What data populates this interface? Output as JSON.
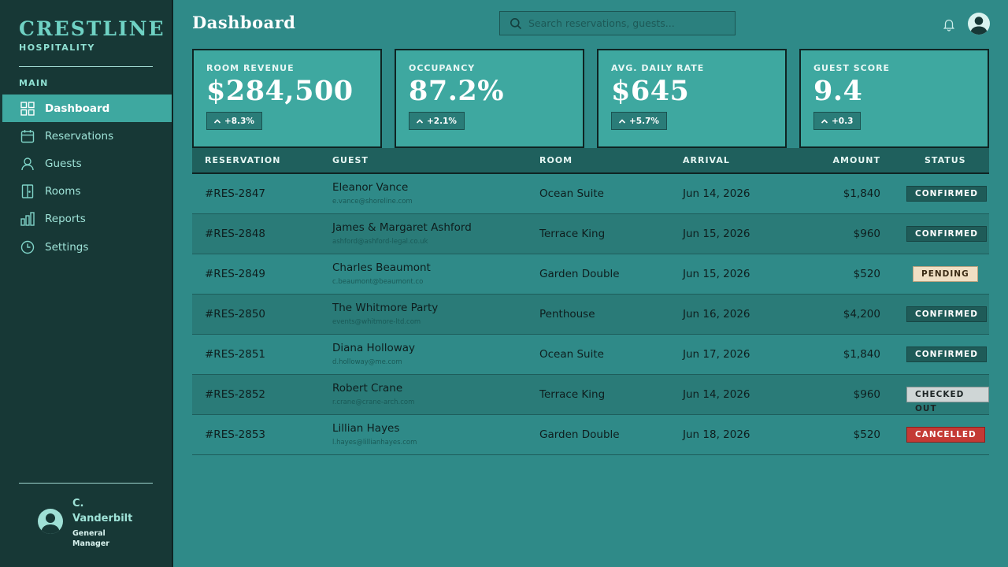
{
  "brand": {
    "name": "CRESTLINE",
    "subtitle": "HOSPITALITY"
  },
  "sidebar": {
    "section_label": "MAIN",
    "items": [
      {
        "label": "Dashboard",
        "icon": "grid-icon",
        "active": true
      },
      {
        "label": "Reservations",
        "icon": "calendar-icon",
        "active": false
      },
      {
        "label": "Guests",
        "icon": "person-icon",
        "active": false
      },
      {
        "label": "Rooms",
        "icon": "door-icon",
        "active": false
      },
      {
        "label": "Reports",
        "icon": "bar-chart-icon",
        "active": false
      },
      {
        "label": "Settings",
        "icon": "clock-icon",
        "active": false
      }
    ]
  },
  "user": {
    "name": "C. Vanderbilt",
    "role": "General Manager"
  },
  "header": {
    "title": "Dashboard",
    "search_placeholder": "Search reservations, guests..."
  },
  "kpis": [
    {
      "label": "ROOM REVENUE",
      "value": "$284,500",
      "delta": "+8.3%"
    },
    {
      "label": "OCCUPANCY",
      "value": "87.2%",
      "delta": "+2.1%"
    },
    {
      "label": "AVG. DAILY RATE",
      "value": "$645",
      "delta": "+5.7%"
    },
    {
      "label": "GUEST SCORE",
      "value": "9.4",
      "delta": "+0.3"
    }
  ],
  "table": {
    "columns": {
      "reservation": "RESERVATION",
      "guest": "GUEST",
      "room": "ROOM",
      "arrival": "ARRIVAL",
      "amount": "AMOUNT",
      "status": "STATUS"
    },
    "rows": [
      {
        "id": "#RES-2847",
        "guest": "Eleanor Vance",
        "email": "e.vance@shoreline.com",
        "room": "Ocean Suite",
        "arrival": "Jun 14, 2026",
        "amount": "$1,840",
        "status": "CONFIRMED"
      },
      {
        "id": "#RES-2848",
        "guest": "James & Margaret Ashford",
        "email": "ashford@ashford-legal.co.uk",
        "room": "Terrace King",
        "arrival": "Jun 15, 2026",
        "amount": "$960",
        "status": "CONFIRMED"
      },
      {
        "id": "#RES-2849",
        "guest": "Charles Beaumont",
        "email": "c.beaumont@beaumont.co",
        "room": "Garden Double",
        "arrival": "Jun 15, 2026",
        "amount": "$520",
        "status": "PENDING"
      },
      {
        "id": "#RES-2850",
        "guest": "The Whitmore Party",
        "email": "events@whitmore-ltd.com",
        "room": "Penthouse",
        "arrival": "Jun 16, 2026",
        "amount": "$4,200",
        "status": "CONFIRMED"
      },
      {
        "id": "#RES-2851",
        "guest": "Diana Holloway",
        "email": "d.holloway@me.com",
        "room": "Ocean Suite",
        "arrival": "Jun 17, 2026",
        "amount": "$1,840",
        "status": "CONFIRMED"
      },
      {
        "id": "#RES-2852",
        "guest": "Robert Crane",
        "email": "r.crane@crane-arch.com",
        "room": "Terrace King",
        "arrival": "Jun 14, 2026",
        "amount": "$960",
        "status": "CHECKED OUT"
      },
      {
        "id": "#RES-2853",
        "guest": "Lillian Hayes",
        "email": "l.hayes@lillianhayes.com",
        "room": "Garden Double",
        "arrival": "Jun 18, 2026",
        "amount": "$520",
        "status": "CANCELLED"
      }
    ]
  }
}
